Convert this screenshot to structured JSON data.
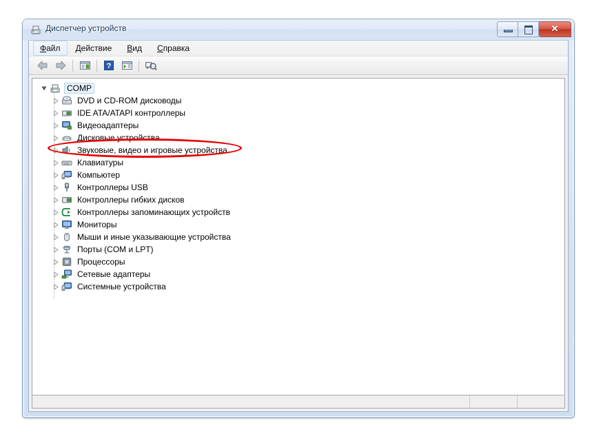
{
  "window": {
    "title": "Диспетчер устройств",
    "title_icon": "device-manager-icon",
    "buttons": {
      "minimize": "−",
      "maximize": "❐",
      "close": "✕"
    }
  },
  "menubar": {
    "items": [
      {
        "label": "Файл",
        "accel": "Ф",
        "rest": "айл",
        "active": true
      },
      {
        "label": "Действие",
        "accel": "Д",
        "rest": "ействие",
        "active": false
      },
      {
        "label": "Вид",
        "accel": "В",
        "rest": "ид",
        "active": false
      },
      {
        "label": "Справка",
        "accel": "С",
        "rest": "правка",
        "active": false
      }
    ]
  },
  "toolbar": {
    "items": [
      {
        "name": "back-arrow-icon",
        "tooltip": "Назад"
      },
      {
        "name": "forward-arrow-icon",
        "tooltip": "Вперед"
      },
      {
        "name": "properties-icon",
        "tooltip": "Свойства"
      },
      {
        "name": "help-icon",
        "tooltip": "Справка"
      },
      {
        "name": "show-hidden-devices-icon",
        "tooltip": "Показать скрытые устройства"
      },
      {
        "name": "scan-hardware-changes-icon",
        "tooltip": "Обновить конфигурацию оборудования"
      }
    ]
  },
  "tree": {
    "root": {
      "label": "COMP",
      "icon": "computer-icon",
      "expanded": true,
      "selected": true
    },
    "children": [
      {
        "label": "DVD и CD-ROM дисководы",
        "icon": "dvd-drive-icon",
        "expanded": false,
        "highlighted": false
      },
      {
        "label": "IDE ATA/ATAPI контроллеры",
        "icon": "ide-controller-icon",
        "expanded": false,
        "highlighted": false
      },
      {
        "label": "Видеоадаптеры",
        "icon": "display-adapter-icon",
        "expanded": false,
        "highlighted": false
      },
      {
        "label": "Дисковые устройства",
        "icon": "disk-drive-icon",
        "expanded": false,
        "highlighted": false
      },
      {
        "label": "Звуковые, видео и игровые устройства",
        "icon": "sound-device-icon",
        "expanded": false,
        "highlighted": true
      },
      {
        "label": "Клавиатуры",
        "icon": "keyboard-icon",
        "expanded": false,
        "highlighted": false
      },
      {
        "label": "Компьютер",
        "icon": "computer-node-icon",
        "expanded": false,
        "highlighted": false
      },
      {
        "label": "Контроллеры USB",
        "icon": "usb-controller-icon",
        "expanded": false,
        "highlighted": false
      },
      {
        "label": "Контроллеры гибких дисков",
        "icon": "floppy-controller-icon",
        "expanded": false,
        "highlighted": false
      },
      {
        "label": "Контроллеры запоминающих устройств",
        "icon": "storage-controller-icon",
        "expanded": false,
        "highlighted": false
      },
      {
        "label": "Мониторы",
        "icon": "monitor-icon",
        "expanded": false,
        "highlighted": false
      },
      {
        "label": "Мыши и иные указывающие устройства",
        "icon": "mouse-icon",
        "expanded": false,
        "highlighted": false
      },
      {
        "label": "Порты (COM и LPT)",
        "icon": "port-icon",
        "expanded": false,
        "highlighted": false
      },
      {
        "label": "Процессоры",
        "icon": "processor-icon",
        "expanded": false,
        "highlighted": false
      },
      {
        "label": "Сетевые адаптеры",
        "icon": "network-adapter-icon",
        "expanded": false,
        "highlighted": false
      },
      {
        "label": "Системные устройства",
        "icon": "system-device-icon",
        "expanded": false,
        "highlighted": false
      }
    ]
  },
  "annotation": {
    "type": "ellipse-highlight",
    "target": "Звуковые, видео и игровые устройства",
    "color": "#e60000"
  },
  "statusbar": {
    "main_text": "",
    "cell2_text": "",
    "cell3_text": ""
  }
}
